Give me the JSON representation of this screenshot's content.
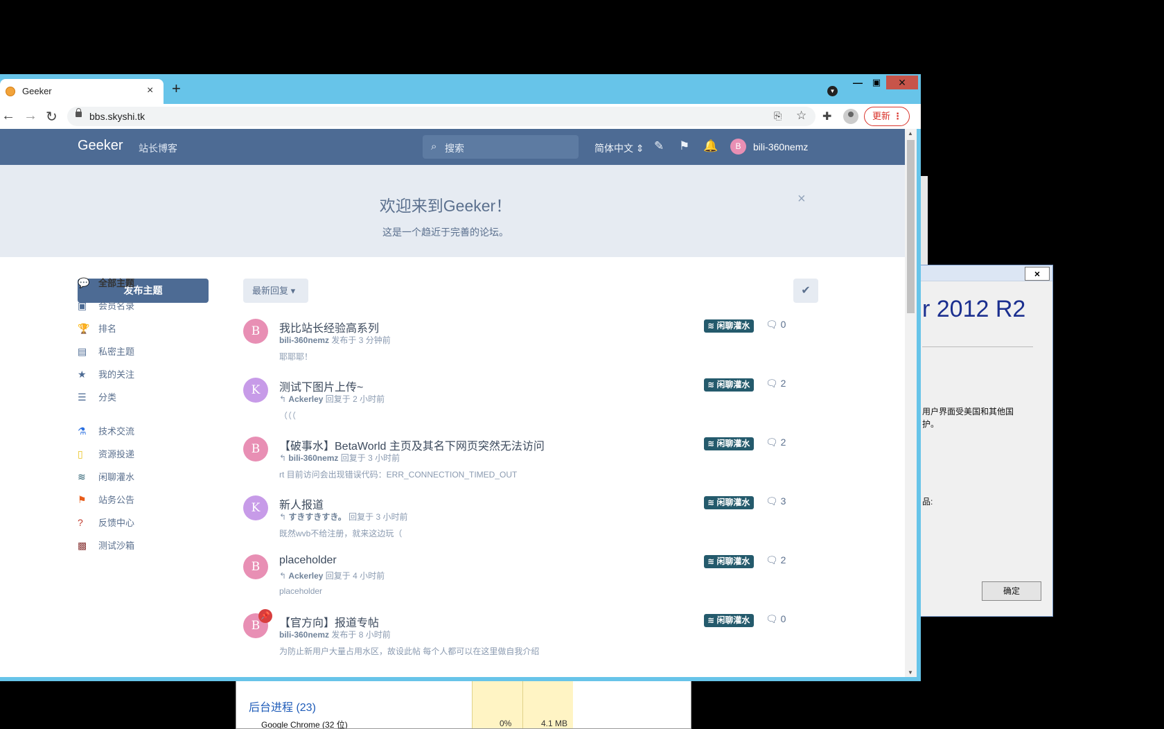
{
  "browser": {
    "tab_title": "Geeker",
    "url": "bbs.skyshi.tk",
    "update_label": "更新",
    "tab_close": "×",
    "new_tab": "+"
  },
  "forum": {
    "logo": "Geeker",
    "blog_link": "站长博客",
    "search_placeholder": "搜索",
    "language": "简体中文 ⇕",
    "avatar_letter": "B",
    "username": "bili-360nemz"
  },
  "hero": {
    "title": "欢迎来到Geeker！",
    "subtitle": "这是一个趋近于完善的论坛。",
    "close": "×"
  },
  "sidebar": {
    "start_button": "发布主题",
    "items": [
      {
        "label": "全部主题",
        "icon": "💬",
        "color": "#4d6b94"
      },
      {
        "label": "会员名录",
        "icon": "▣",
        "color": "#4d6b94"
      },
      {
        "label": "排名",
        "icon": "🏆",
        "color": "#4d6b94"
      },
      {
        "label": "私密主题",
        "icon": "▤",
        "color": "#4d6b94"
      },
      {
        "label": "我的关注",
        "icon": "★",
        "color": "#4d6b94"
      },
      {
        "label": "分类",
        "icon": "☰",
        "color": "#4d6b94"
      },
      {
        "label": "技术交流",
        "icon": "⚗",
        "color": "#2a6fe0"
      },
      {
        "label": "资源投递",
        "icon": "▯",
        "color": "#e8c21a"
      },
      {
        "label": "闲聊灌水",
        "icon": "≋",
        "color": "#245a6c"
      },
      {
        "label": "站务公告",
        "icon": "⚑",
        "color": "#e85c1a"
      },
      {
        "label": "反馈中心",
        "icon": "?",
        "color": "#c0392b"
      },
      {
        "label": "测试沙箱",
        "icon": "▩",
        "color": "#8b3a3a"
      }
    ]
  },
  "list": {
    "sort_label": "最新回复 ▾",
    "mark_read": "✔",
    "discussions": [
      {
        "avatar": "B",
        "avatar_color": "#e88fb4",
        "title": "我比站长经验高系列",
        "user": "bili-360nemz",
        "action": " 发布于 3 分钟前",
        "excerpt": "耶耶耶！",
        "tag": "≋ 闲聊灌水",
        "replies": "0",
        "reply_icon": false,
        "pinned": false
      },
      {
        "avatar": "K",
        "avatar_color": "#c79be8",
        "title": "测试下图片上传~",
        "user": "Ackerley",
        "action": " 回复于 2 小时前",
        "excerpt": "（（（",
        "tag": "≋ 闲聊灌水",
        "replies": "2",
        "reply_icon": true,
        "pinned": false
      },
      {
        "avatar": "B",
        "avatar_color": "#e88fb4",
        "title": "【破事水】BetaWorld 主页及其名下网页突然无法访问",
        "user": "bili-360nemz",
        "action": " 回复于 3 小时前",
        "excerpt": "rt 目前访问会出现错误代码：ERR_CONNECTION_TIMED_OUT",
        "tag": "≋ 闲聊灌水",
        "replies": "2",
        "reply_icon": true,
        "pinned": false
      },
      {
        "avatar": "K",
        "avatar_color": "#c79be8",
        "title": "新人报道",
        "user": "すきすきすき。",
        "action": " 回复于 3 小时前",
        "excerpt": "既然wvb不给注册，就来这边玩（",
        "tag": "≋ 闲聊灌水",
        "replies": "3",
        "reply_icon": true,
        "pinned": false
      },
      {
        "avatar": "B",
        "avatar_color": "#e88fb4",
        "title": "placeholder",
        "user": "Ackerley",
        "action": " 回复于 4 小时前",
        "excerpt": "placeholder",
        "tag": "≋ 闲聊灌水",
        "replies": "2",
        "reply_icon": true,
        "pinned": false
      },
      {
        "avatar": "B",
        "avatar_color": "#e88fb4",
        "title": "【官方向】报道专帖",
        "user": "bili-360nemz",
        "action": " 发布于 8 小时前",
        "excerpt": "为防止新用户大量占用水区，故设此帖 每个人都可以在这里做自我介绍",
        "tag": "≋ 闲聊灌水",
        "replies": "0",
        "reply_icon": false,
        "pinned": true
      }
    ]
  },
  "about_dialog": {
    "brand": "r 2012 R2",
    "line1": "用户界面受美国和其他国",
    "line2": "护。",
    "line3": "品:",
    "ok": "确定",
    "close": "×"
  },
  "task_manager": {
    "group": "后台进程 (23)",
    "process": "Google Chrome (32 位)",
    "cpu": "0%",
    "memory": "4.1 MB"
  }
}
